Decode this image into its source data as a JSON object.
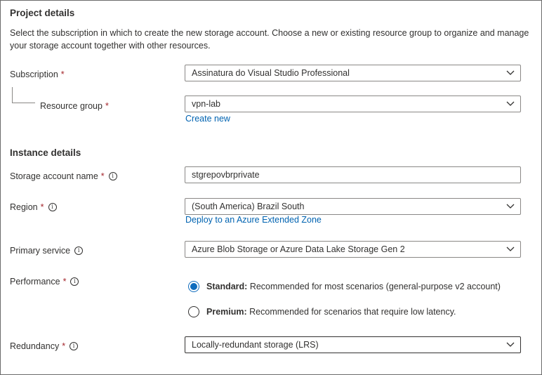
{
  "project": {
    "heading": "Project details",
    "description": "Select the subscription in which to create the new storage account. Choose a new or existing resource group to organize and manage your storage account together with other resources."
  },
  "subscription": {
    "label": "Subscription",
    "value": "Assinatura do Visual Studio Professional"
  },
  "resource_group": {
    "label": "Resource group",
    "value": "vpn-lab",
    "create_new": "Create new"
  },
  "instance": {
    "heading": "Instance details"
  },
  "storage_account_name": {
    "label": "Storage account name",
    "value": "stgrepovbrprivate"
  },
  "region": {
    "label": "Region",
    "value": "(South America) Brazil South",
    "link": "Deploy to an Azure Extended Zone"
  },
  "primary_service": {
    "label": "Primary service",
    "value": "Azure Blob Storage or Azure Data Lake Storage Gen 2"
  },
  "performance": {
    "label": "Performance",
    "options": [
      {
        "name": "Standard:",
        "desc": "Recommended for most scenarios (general-purpose v2 account)",
        "selected": true
      },
      {
        "name": "Premium:",
        "desc": "Recommended for scenarios that require low latency.",
        "selected": false
      }
    ]
  },
  "redundancy": {
    "label": "Redundancy",
    "value": "Locally-redundant storage (LRS)"
  },
  "required_mark": "*",
  "info_glyph": "i",
  "colors": {
    "link": "#0063b1",
    "required": "#a4262c",
    "radio_selected": "#0f6cbd"
  }
}
